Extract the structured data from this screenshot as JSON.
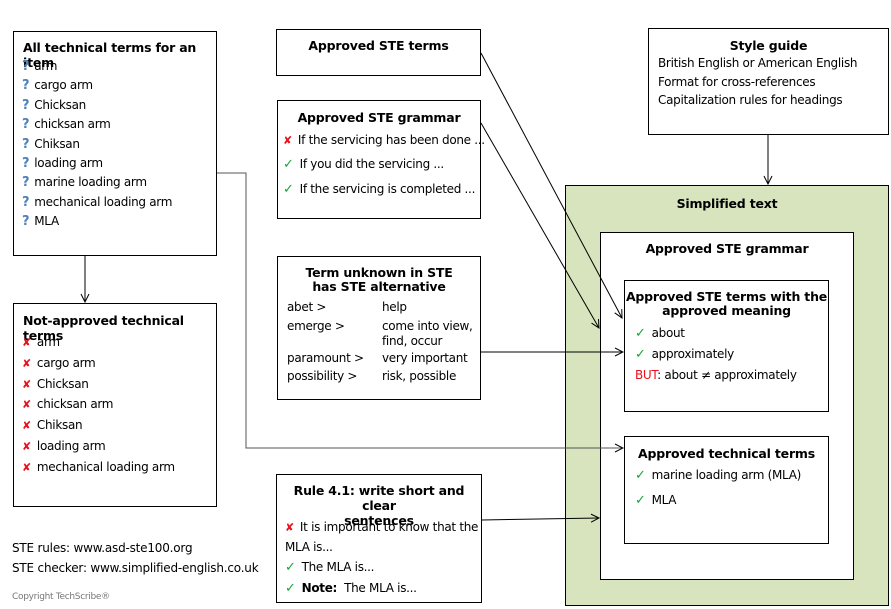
{
  "all_terms": {
    "title": "All technical terms for an item",
    "icon": "question-icon",
    "items": [
      "arm",
      "cargo arm",
      "Chicksan",
      "chicksan arm",
      "Chiksan",
      "loading arm",
      "marine loading arm",
      "mechanical loading arm",
      "MLA"
    ]
  },
  "not_approved": {
    "title": "Not-approved technical terms",
    "icon": "cross-icon",
    "items": [
      "arm",
      "cargo arm",
      "Chicksan",
      "chicksan arm",
      "Chiksan",
      "loading arm",
      "mechanical loading arm"
    ]
  },
  "approved_ste_terms": {
    "title": "Approved STE terms"
  },
  "approved_ste_grammar": {
    "title": "Approved STE grammar",
    "examples": [
      {
        "status": "cross",
        "text": "If the servicing has been done ..."
      },
      {
        "status": "check",
        "text": "If you did the servicing ..."
      },
      {
        "status": "check",
        "text": "If the servicing is completed ..."
      }
    ]
  },
  "term_unknown": {
    "title_line1": "Term unknown in STE",
    "title_line2": "has STE alternative",
    "rows": [
      {
        "term": "abet >",
        "alt": "help"
      },
      {
        "term": "emerge >",
        "alt": "come into view,",
        "alt2": "find, occur"
      },
      {
        "term": "paramount >",
        "alt": "very important"
      },
      {
        "term": "possibility >",
        "alt": "risk, possible"
      }
    ]
  },
  "rule_41": {
    "title_line1": "Rule 4.1: write short and clear",
    "title_line2": "sentences",
    "bad_line1": "It is important to know that the",
    "bad_line2": "MLA is...",
    "good1": "The MLA is...",
    "good2_bold": "Note:",
    "good2_text": "The MLA is..."
  },
  "style_guide": {
    "title": "Style guide",
    "items": [
      "British English or American English",
      "Format for cross-references",
      "Capitalization rules for headings"
    ]
  },
  "simplified_text": {
    "title": "Simplified text",
    "grammar_title": "Approved STE grammar",
    "terms_meaning": {
      "title_line1": "Approved STE terms with the",
      "title_line2": "approved meaning",
      "items": [
        "about",
        "approximately"
      ],
      "but_label": "BUT",
      "but_text": ": about ≠ approximately"
    },
    "tech_terms": {
      "title": "Approved technical terms",
      "items": [
        "marine loading arm (MLA)",
        "MLA"
      ]
    }
  },
  "footer": {
    "rules": "STE rules: www.asd-ste100.org",
    "checker": "STE checker: www.simplified-english.co.uk",
    "copyright": "Copyright  TechScribe®"
  },
  "colors": {
    "simplified_bg": "#d7e4bd",
    "check": "#14a63a",
    "cross": "#e8101b",
    "question": "#4f81bd"
  }
}
